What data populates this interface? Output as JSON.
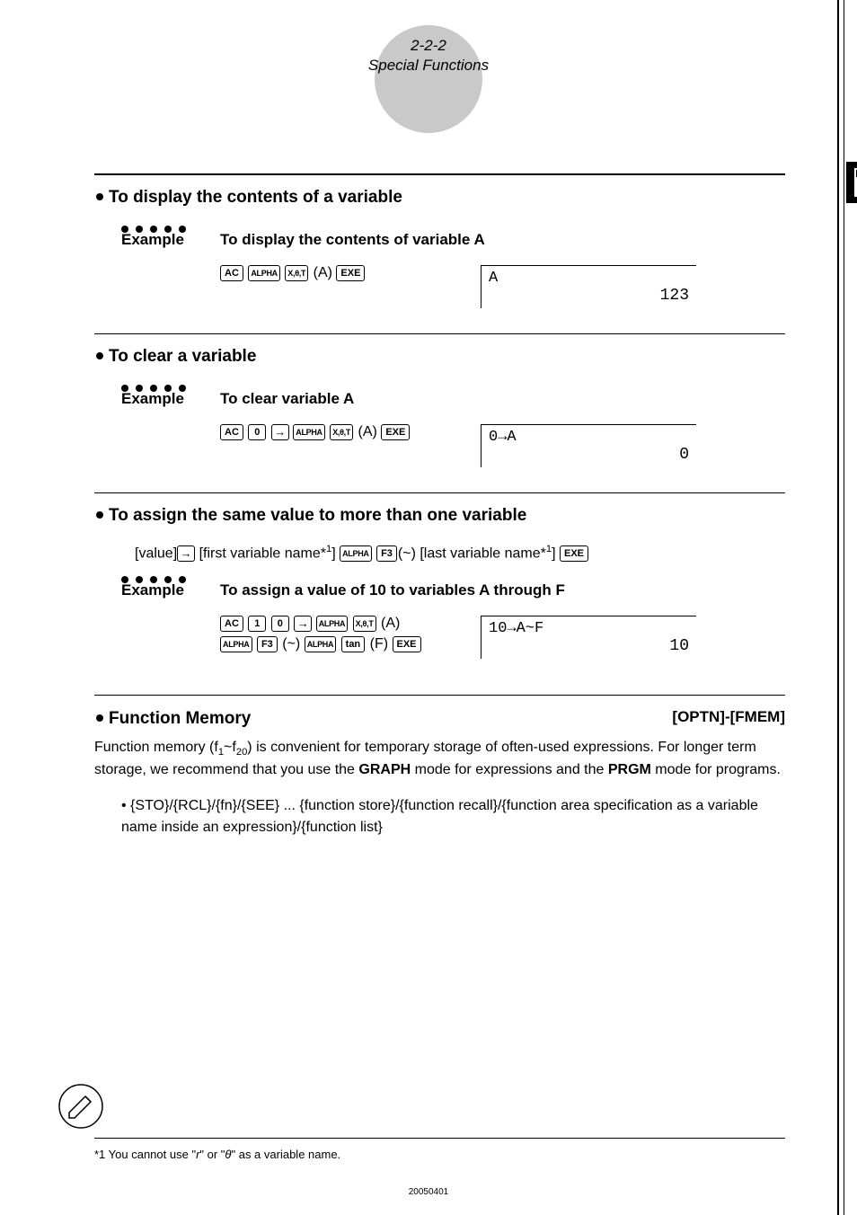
{
  "header": {
    "page_ref": "2-2-2",
    "section_title": "Special Functions"
  },
  "sections": [
    {
      "title": "To display the contents of a variable",
      "example_label": "Example",
      "example_desc": "To display the contents of variable A",
      "key_sequence": [
        "AC",
        "ALPHA",
        "X,θ,T",
        "(A)",
        "EXE"
      ],
      "lcd_line1": "A",
      "lcd_result": "123"
    },
    {
      "title": "To clear a variable",
      "example_label": "Example",
      "example_desc": "To clear variable A",
      "key_sequence": [
        "AC",
        "0",
        "→",
        "ALPHA",
        "X,θ,T",
        "(A)",
        "EXE"
      ],
      "lcd_line1": "0→A",
      "lcd_result": "0"
    },
    {
      "title": "To assign the same value to more than one variable",
      "syntax_line": "[value] → [first variable name*¹] ALPHA F3 (~) [last variable name*¹] EXE",
      "example_label": "Example",
      "example_desc": "To assign a value of 10 to variables A through F",
      "key_sequence_1": [
        "AC",
        "1",
        "0",
        "→",
        "ALPHA",
        "X,θ,T",
        "(A)"
      ],
      "key_sequence_2": [
        "ALPHA",
        "F3",
        "(~)",
        "ALPHA",
        "tan",
        "(F)",
        "EXE"
      ],
      "lcd_line1": "10→A~F",
      "lcd_result": "10"
    }
  ],
  "function_memory": {
    "title": "Function Memory",
    "menu_path": "[OPTN]-[FMEM]",
    "body_pre_sub": "Function memory (f",
    "body_sub1": "1",
    "body_mid": "~f",
    "body_sub2": "20",
    "body_post_sub": ") is convenient for temporary storage of often-used expressions. For longer term storage, we recommend that you use the ",
    "graph": "GRAPH",
    "body_post_graph": " mode for expressions and the ",
    "prgm": "PRGM",
    "body_tail": " mode for programs.",
    "menu_items_prefix": "• {",
    "sto": "STO",
    "slash1": "}/{",
    "rcl": "RCL",
    "slash2": "}/{",
    "fn": "fn",
    "slash3": "}/{",
    "see": "SEE",
    "menu_items_suffix": "} ... {function store}/{function recall}/{function area specification as a variable name inside an expression}/{function list}"
  },
  "footnote": {
    "marker": "*1",
    "text": " You cannot use \"r\" or \"θ\" as a variable name."
  },
  "footer_date": "20050401"
}
